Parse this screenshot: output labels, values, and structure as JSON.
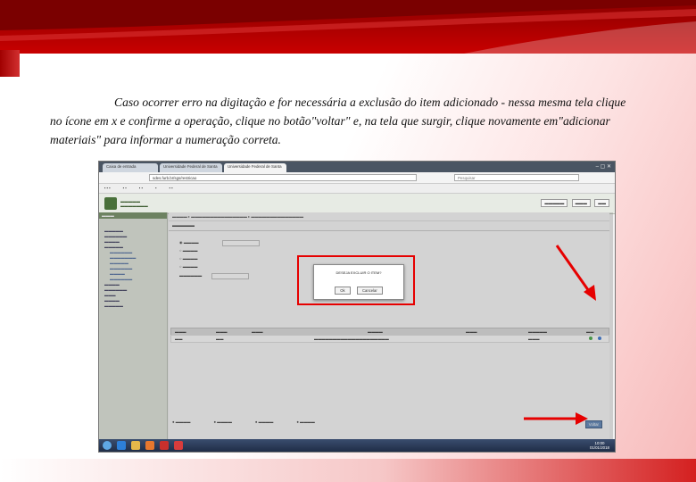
{
  "caption": {
    "line1": "Caso ocorrer erro na digitação e for necessária a exclusão do item adicionado - nessa mesma tela clique",
    "line2": "no ícone em x e confirme a operação, clique no botão\"voltar\" e, na tela que surgir, clique novamente em\"adicionar",
    "line3": "materiais\" para informar a numeração correta."
  },
  "colors": {
    "banner": "#b00000",
    "highlight": "#e60000",
    "sidebar_green": "#6c8a5c"
  },
  "screenshot": {
    "browser_tabs": [
      "Caixa de entrada",
      "Universidade Federal de Santa",
      "Universidade Federal de Santa"
    ],
    "address": "sdes.furb.br/sgs/restricao",
    "search_placeholder": "Pesquisar",
    "dialog": {
      "message": "DESEJA EXCLUIR O ITEM?",
      "ok": "Ok",
      "cancel": "Cancelar"
    },
    "voltar": "Voltar",
    "clock": {
      "time": "10:00",
      "date": "01/01/2018"
    }
  }
}
